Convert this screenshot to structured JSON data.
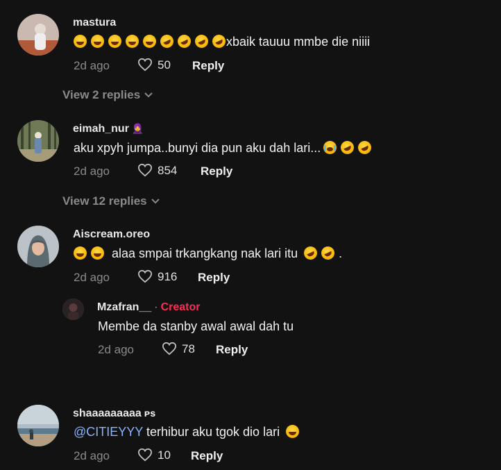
{
  "comments": [
    {
      "username": "mastura",
      "badge": "",
      "text": "xbaik tauuu mmbe die niiii",
      "time": "2d ago",
      "likes": "50",
      "reply_label": "Reply",
      "view_replies": "View 2 replies"
    },
    {
      "username": "eimah_nur",
      "badge": "🧕",
      "text": "aku xpyh jumpa..bunyi dia pun aku dah lari...",
      "time": "2d ago",
      "likes": "854",
      "reply_label": "Reply",
      "view_replies": "View 12 replies"
    },
    {
      "username": "Aiscream.oreo",
      "badge": "",
      "text_before": " alaa smpai trkangkang nak lari itu ",
      "text_after": ".",
      "time": "2d ago",
      "likes": "916",
      "reply_label": "Reply"
    },
    {
      "username": "shaaaaaaaaa",
      "badge": "ᴘs",
      "mention": "@CITIEYYY",
      "text": " terhibur aku tgok dio lari ",
      "time": "2d ago",
      "likes": "10",
      "reply_label": "Reply"
    }
  ],
  "reply": {
    "username": "Mzafran__",
    "separator": "·",
    "creator_label": "Creator",
    "text": "Membe da stanby awal awal dah tu",
    "time": "2d ago",
    "likes": "78",
    "reply_label": "Reply"
  },
  "colors": {
    "background": "#121212",
    "creator": "#fe2c55",
    "mention": "#8ab4ff",
    "muted": "#8a8a8a"
  },
  "icons": [
    "heart-icon",
    "chevron-down-icon",
    "laughing-emoji",
    "rofl-emoji",
    "sob-emoji"
  ]
}
